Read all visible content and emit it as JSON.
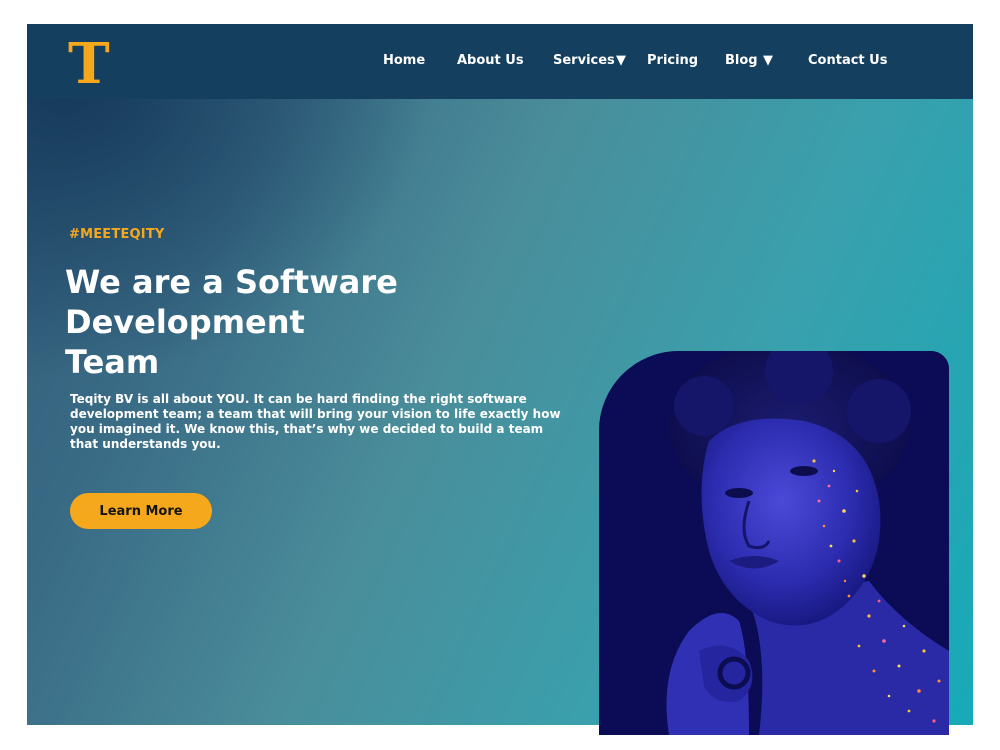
{
  "brand": {
    "logo_letter": "T",
    "accent_color": "#f6a81d",
    "nav_bg": "#143f5f"
  },
  "nav": {
    "items": [
      {
        "label": "Home",
        "has_dropdown": false
      },
      {
        "label": "About Us",
        "has_dropdown": false
      },
      {
        "label": "Services",
        "has_dropdown": true
      },
      {
        "label": "Pricing",
        "has_dropdown": false
      },
      {
        "label": "Blog",
        "has_dropdown": true
      },
      {
        "label": "Contact Us",
        "has_dropdown": false
      }
    ],
    "dropdown_glyph": "▼"
  },
  "hero": {
    "tag": "#MEETEQITY",
    "headline_line1": "We are a Software Development",
    "headline_line2": "Team",
    "description": "Teqity BV is all about YOU.  It can be hard finding the right software development team; a team that will bring your vision to life exactly how you imagined it. We know this, that’s why we decided to build a team that understands you.",
    "cta_label": "Learn More",
    "image_icon": "portrait-photo"
  }
}
